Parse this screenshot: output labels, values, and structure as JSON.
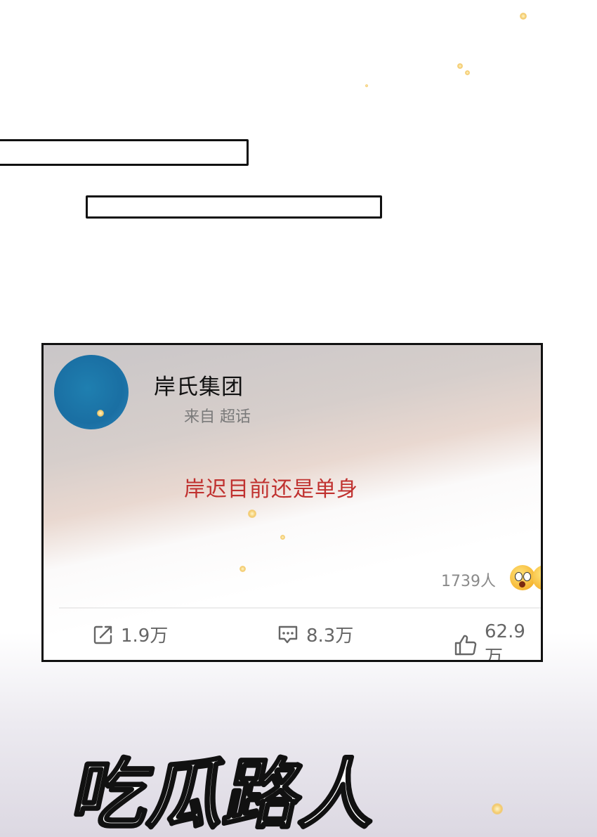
{
  "post": {
    "poster_name": "岸氏集团",
    "source": "来自 超话",
    "body": "岸迟目前还是单身",
    "reactions": {
      "count": "1739人",
      "emoji": [
        "shocked-face-icon"
      ]
    },
    "actions": {
      "share": {
        "icon": "share-icon",
        "label": "1.9万"
      },
      "comment": {
        "icon": "comment-icon",
        "label": "8.3万"
      },
      "like": {
        "icon": "thumbs-up-icon",
        "label": "62.9万"
      }
    }
  },
  "caption_art": {
    "text": "吃瓜路人"
  },
  "colors": {
    "avatar": "#1a6fa3",
    "body_text": "#c0312f",
    "meta_text": "#7a7a7a"
  }
}
